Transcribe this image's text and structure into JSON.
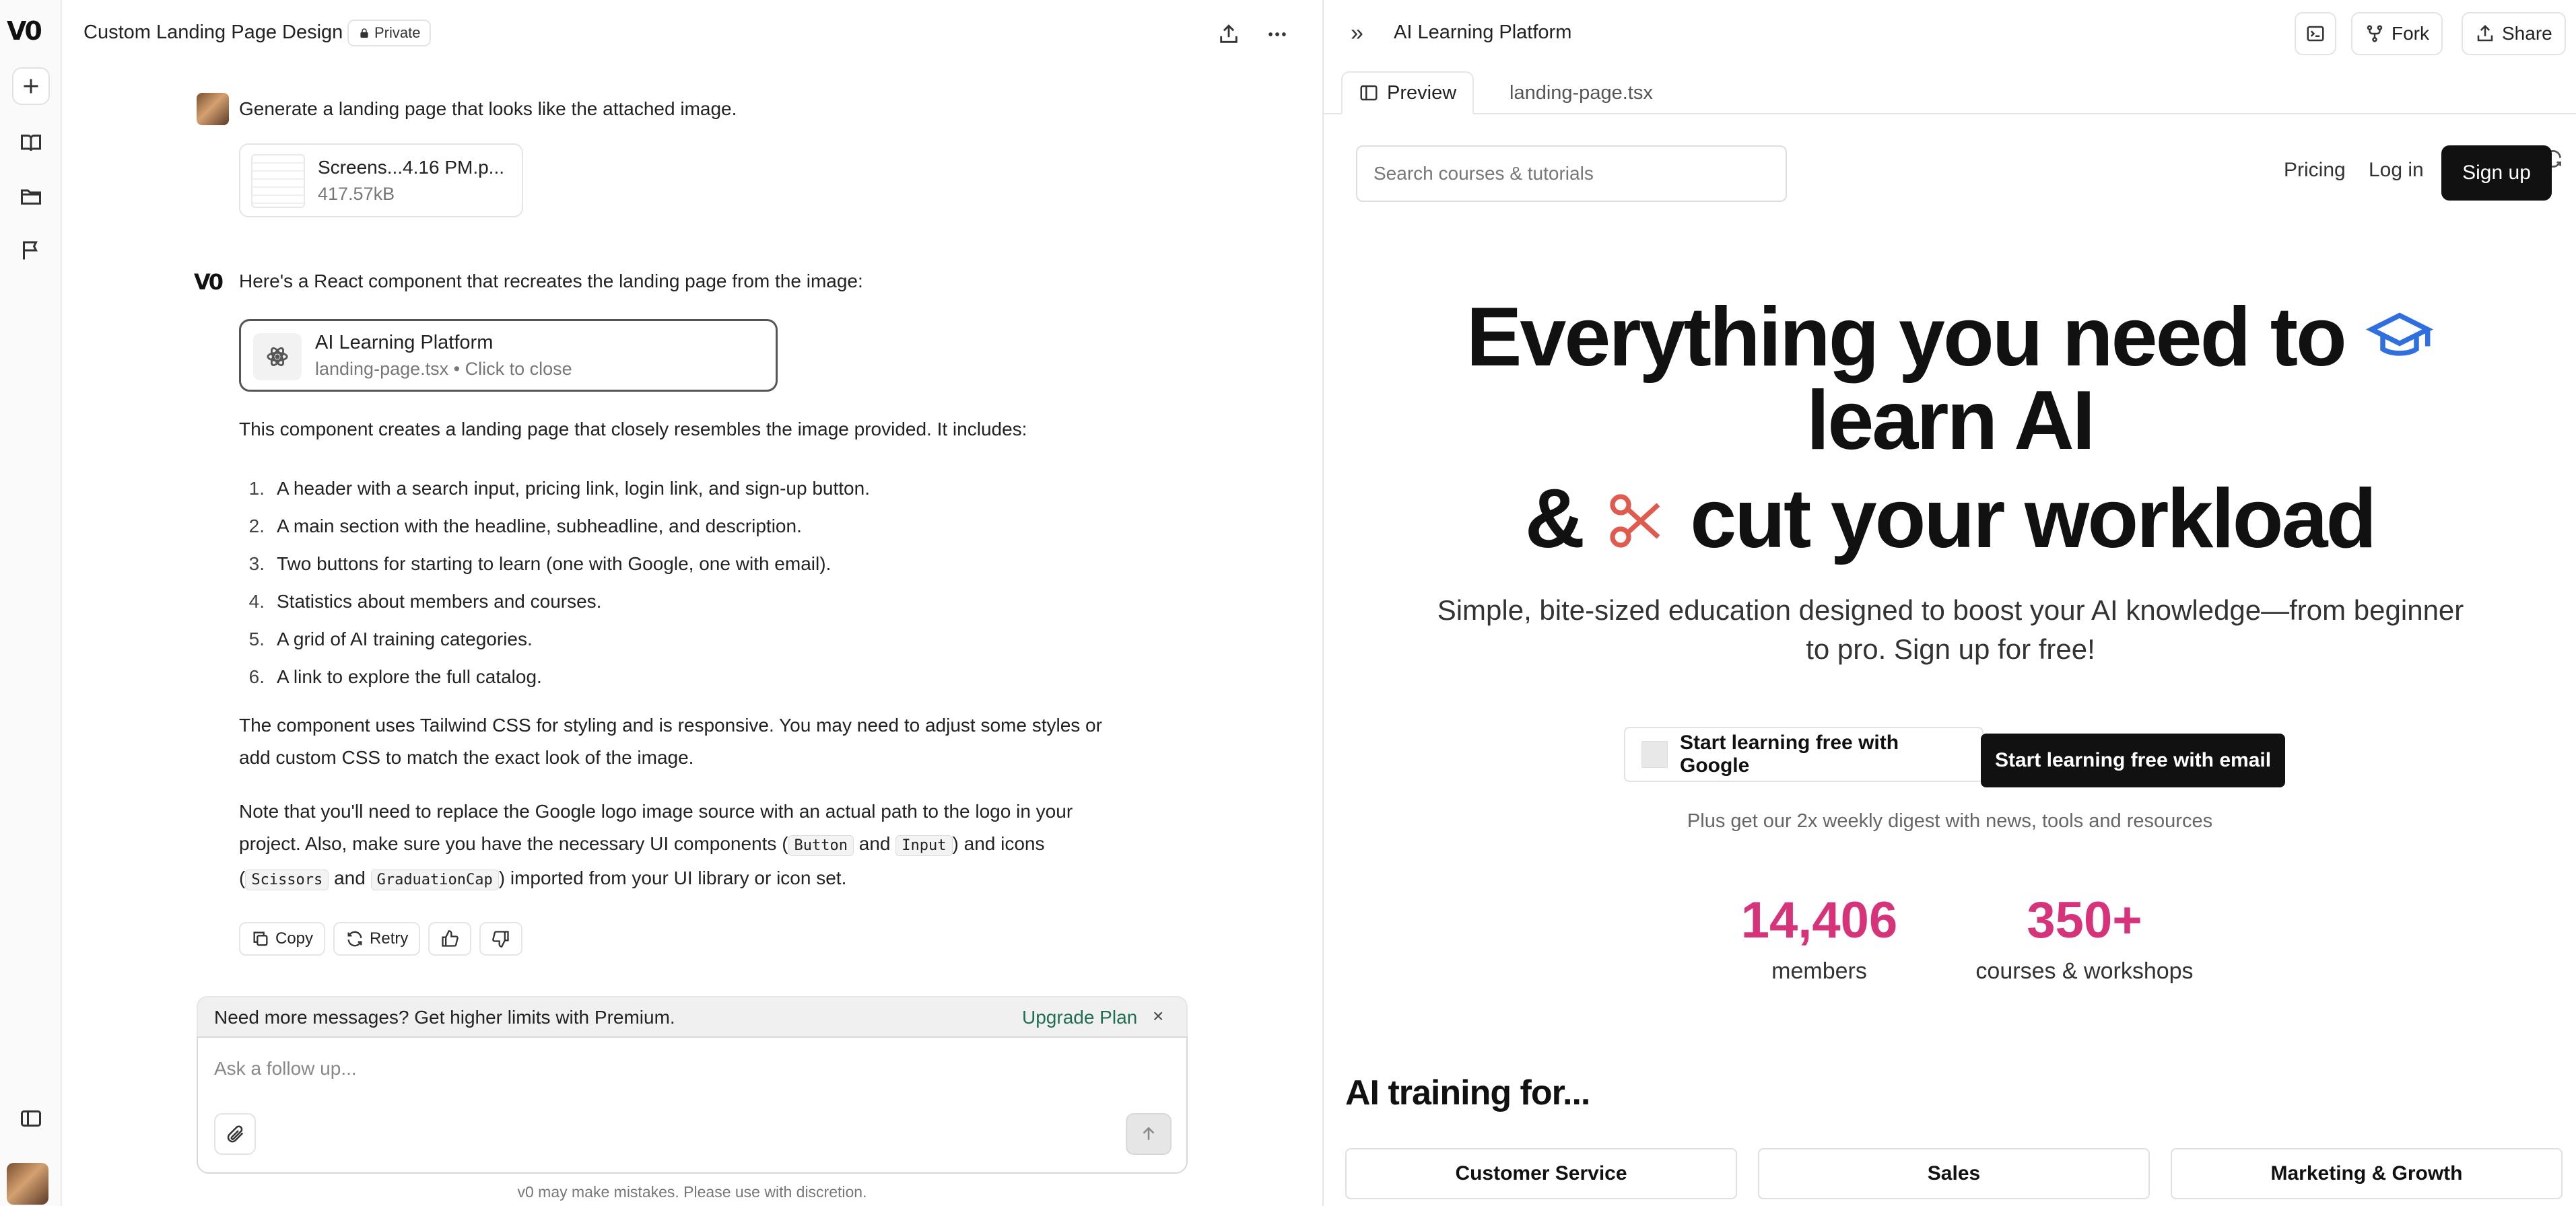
{
  "rail": {
    "logo": "V0",
    "items": [
      {
        "name": "new-chat-button",
        "icon": "plus-icon"
      },
      {
        "name": "library-button",
        "icon": "book-icon"
      },
      {
        "name": "projects-button",
        "icon": "folder-icon"
      },
      {
        "name": "feedback-button",
        "icon": "flag-icon"
      }
    ],
    "sidebar_toggle_icon": "sidebar-icon"
  },
  "chat": {
    "title": "Custom Landing Page Design",
    "visibility": "Private",
    "user_message": "Generate a landing page that looks like the attached image.",
    "attachment": {
      "name": "Screens...4.16 PM.p...",
      "size": "417.57kB"
    },
    "assistant_intro": "Here's a React component that recreates the landing page from the image:",
    "code_card": {
      "title": "AI Learning Platform",
      "subtitle": "landing-page.tsx • Click to close"
    },
    "description": "This component creates a landing page that closely resembles the image provided. It includes:",
    "list": [
      "A header with a search input, pricing link, login link, and sign-up button.",
      "A main section with the headline, subheadline, and description.",
      "Two buttons for starting to learn (one with Google, one with email).",
      "Statistics about members and courses.",
      "A grid of AI training categories.",
      "A link to explore the full catalog."
    ],
    "para1": "The component uses Tailwind CSS for styling and is responsive. You may need to adjust some styles or add custom CSS to match the exact look of the image.",
    "para2_a": "Note that you'll need to replace the Google logo image source with an actual path to the logo in your project. Also, make sure you have the necessary UI components (",
    "code_button": "Button",
    "and": "and",
    "code_input": "Input",
    "para2_b": ") and icons (",
    "code_scissors": "Scissors",
    "code_grad": "GraduationCap",
    "para2_c": ") imported from your UI library or icon set.",
    "actions": {
      "copy": "Copy",
      "retry": "Retry"
    },
    "upsell": {
      "text": "Need more messages? Get higher limits with Premium.",
      "link": "Upgrade Plan",
      "close": "×"
    },
    "composer_placeholder": "Ask a follow up...",
    "disclaimer": "v0 may make mistakes. Please use with discretion."
  },
  "preview": {
    "title": "AI Learning Platform",
    "buttons": {
      "fork": "Fork",
      "share": "Share"
    },
    "tabs": [
      {
        "label": "Preview",
        "active": true
      },
      {
        "label": "landing-page.tsx",
        "active": false
      }
    ],
    "page": {
      "search_placeholder": "Search courses & tutorials",
      "nav": {
        "pricing": "Pricing",
        "login": "Log in",
        "signup": "Sign up"
      },
      "hero": {
        "line1": "Everything you need to",
        "line2": "learn AI",
        "line3_a": "&",
        "line3_b": "cut your workload"
      },
      "subhead": "Simple, bite-sized education designed to boost your AI knowledge—from beginner to pro. Sign up for free!",
      "cta_google": "Start learning free with Google",
      "cta_email": "Start learning free with email",
      "digest": "Plus get our 2x weekly digest with news, tools and resources",
      "stats": [
        {
          "value": "14,406",
          "label": "members"
        },
        {
          "value": "350+",
          "label": "courses & workshops"
        }
      ],
      "training_title": "AI training for...",
      "categories": [
        "Customer Service",
        "Sales",
        "Marketing & Growth"
      ]
    }
  },
  "colors": {
    "accent_pink": "#d6337a",
    "upgrade_green": "#1f6f4f",
    "grad_cap_blue": "#2f6fe0",
    "scissors_red": "#e05a4e"
  }
}
